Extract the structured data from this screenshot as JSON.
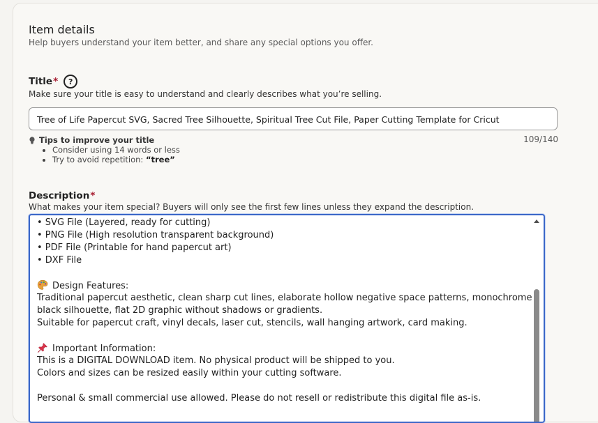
{
  "section": {
    "title": "Item details",
    "subtitle": "Help buyers understand your item better, and share any special options you offer."
  },
  "title_field": {
    "label": "Title",
    "required_mark": "*",
    "help_icon": "?",
    "hint": "Make sure your title is easy to understand and clearly describes what you’re selling.",
    "value": "Tree of Life Papercut SVG, Sacred Tree Silhouette, Spiritual Tree Cut File, Paper Cutting Template for Cricut",
    "counter": "109/140",
    "tips_heading": "Tips to improve your title",
    "tips": [
      {
        "text": "Consider using 14 words or less",
        "bold": ""
      },
      {
        "text": "Try to avoid repetition: ",
        "bold": "“tree”"
      }
    ]
  },
  "description_field": {
    "label": "Description",
    "required_mark": "*",
    "hint": "What makes your item special? Buyers will only see the first few lines unless they expand the description.",
    "lines": [
      "• SVG File (Layered, ready for cutting)",
      "• PNG File (High resolution transparent background)",
      "• PDF File (Printable for hand papercut art)",
      "• DXF File",
      "",
      "Design Features:",
      "Traditional papercut aesthetic, clean sharp cut lines, elaborate hollow negative space patterns, monochrome",
      "black silhouette, flat 2D graphic without shadows or gradients.",
      "Suitable for papercut craft, vinyl decals, laser cut, stencils, wall hanging artwork, card making.",
      "",
      "Important Information:",
      "This is a DIGITAL DOWNLOAD item. No physical product will be shipped to you.",
      "Colors and sizes can be resized easily within your cutting software.",
      "",
      "Personal & small commercial use allowed. Please do not resell or redistribute this digital file as-is."
    ]
  },
  "colors": {
    "required": "#a61a2e",
    "focus_border": "#3b67c8",
    "background": "#f5f4f1"
  },
  "icons": {
    "help": "help-circle-icon",
    "tips": "lightbulb-icon",
    "palette": "palette-emoji-icon",
    "pin": "pushpin-emoji-icon"
  }
}
